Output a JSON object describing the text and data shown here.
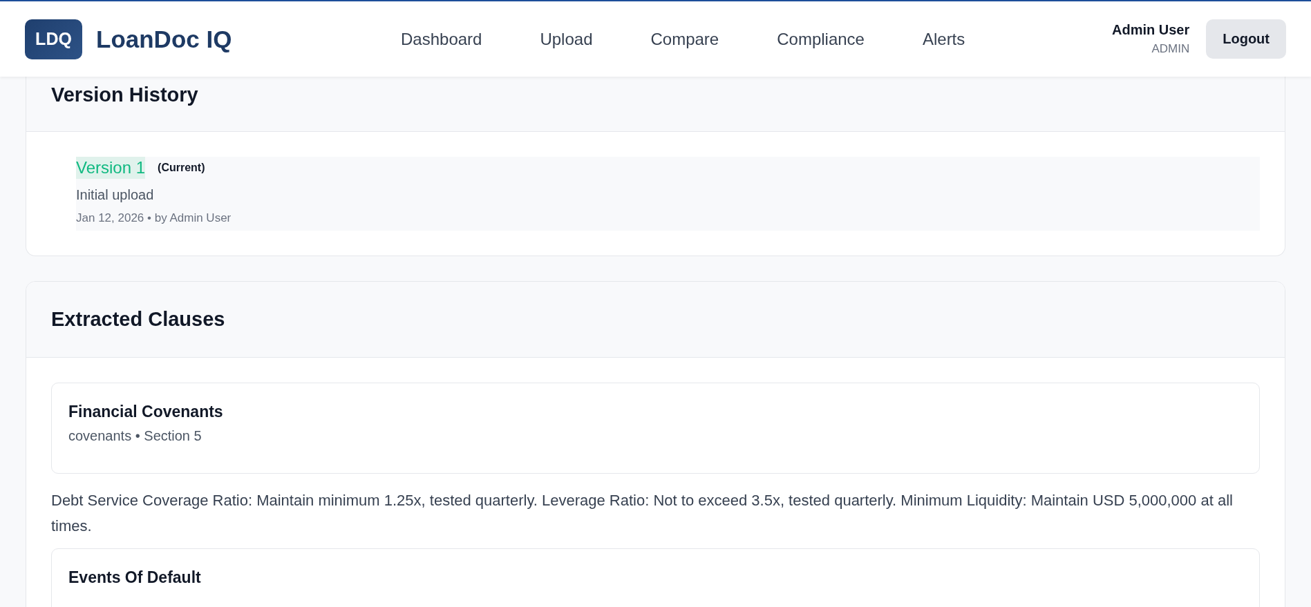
{
  "header": {
    "logo": "LDQ",
    "app_name": "LoanDoc IQ",
    "nav": [
      "Dashboard",
      "Upload",
      "Compare",
      "Compliance",
      "Alerts"
    ],
    "user": {
      "name": "Admin User",
      "role": "ADMIN"
    },
    "logout": "Logout"
  },
  "version_history": {
    "title": "Version History",
    "versions": [
      {
        "label": "Version 1",
        "badge": "(Current)",
        "note": "Initial upload",
        "meta": "Jan 12, 2026 • by Admin User",
        "selected": true
      }
    ]
  },
  "extracted_clauses": {
    "title": "Extracted Clauses",
    "clauses": [
      {
        "title": "Financial Covenants",
        "meta": "covenants • Section 5",
        "text": "Debt Service Coverage Ratio: Maintain minimum 1.25x, tested quarterly. Leverage Ratio: Not to exceed 3.5x, tested quarterly. Minimum Liquidity: Maintain USD 5,000,000 at all times."
      },
      {
        "title": "Events Of Default"
      }
    ]
  }
}
